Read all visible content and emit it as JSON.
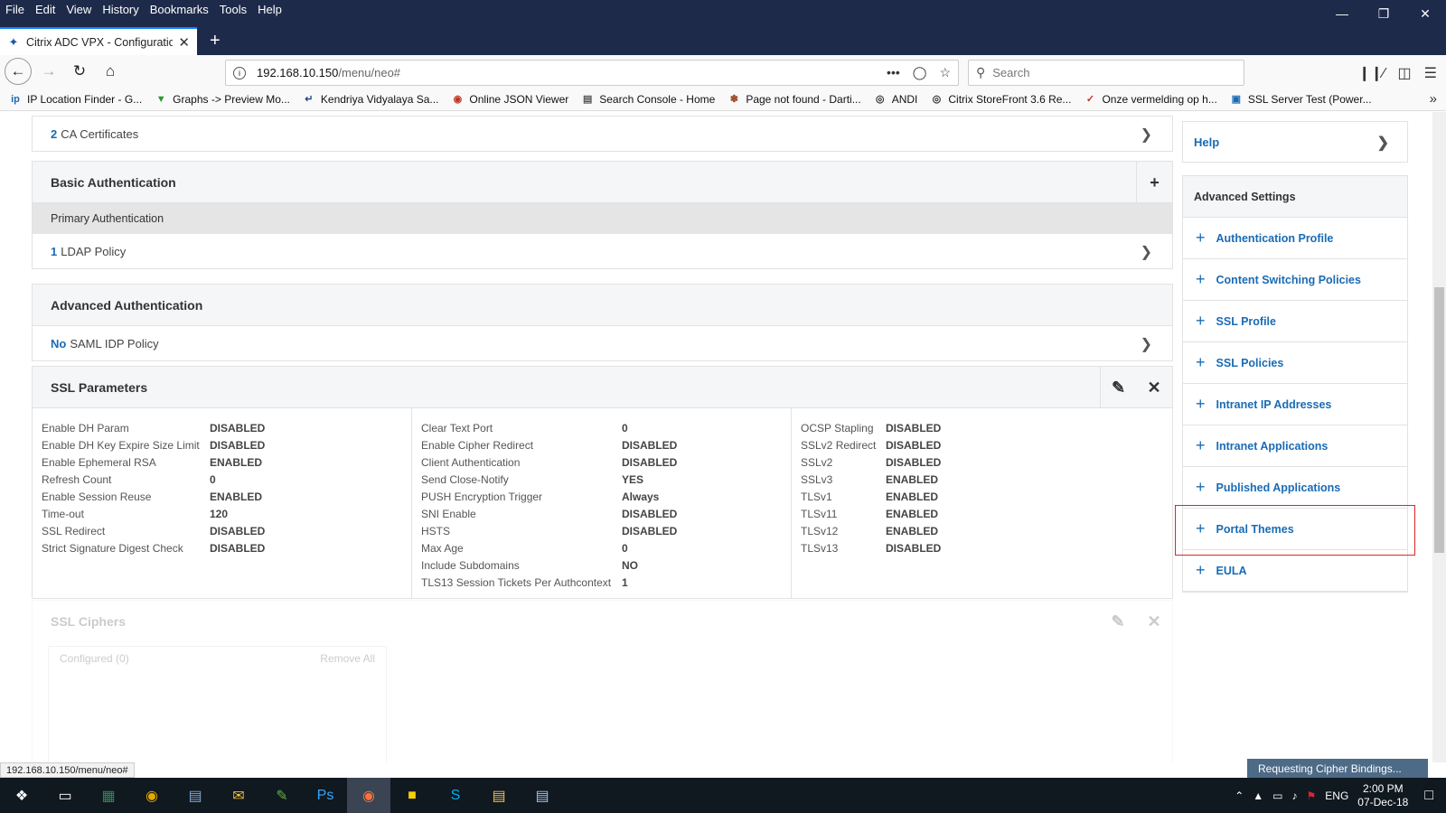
{
  "menu": [
    "File",
    "Edit",
    "View",
    "History",
    "Bookmarks",
    "Tools",
    "Help"
  ],
  "tab": {
    "title": "Citrix ADC VPX - Configuration"
  },
  "url": {
    "host": "192.168.10.150",
    "path": "/menu/neo#"
  },
  "search": {
    "placeholder": "Search"
  },
  "bookmarks": [
    {
      "icon": "ip-icon",
      "label": "IP Location Finder - G..."
    },
    {
      "icon": "leaf-icon",
      "label": "Graphs -> Preview Mo..."
    },
    {
      "icon": "kv-icon",
      "label": "Kendriya Vidyalaya Sa..."
    },
    {
      "icon": "json-icon",
      "label": "Online JSON Viewer"
    },
    {
      "icon": "console-icon",
      "label": "Search Console - Home"
    },
    {
      "icon": "dart-icon",
      "label": "Page not found - Darti..."
    },
    {
      "icon": "globe-icon",
      "label": "ANDI"
    },
    {
      "icon": "citrix-icon",
      "label": "Citrix StoreFront 3.6 Re..."
    },
    {
      "icon": "check-icon",
      "label": "Onze vermelding op h..."
    },
    {
      "icon": "lock-icon",
      "label": "SSL Server Test (Power..."
    }
  ],
  "ca": {
    "count": "2",
    "label": "CA Certificates"
  },
  "basic_auth": {
    "title": "Basic Authentication",
    "sub": "Primary Authentication",
    "count": "1",
    "label": "LDAP Policy"
  },
  "adv_auth": {
    "title": "Advanced Authentication",
    "count": "No",
    "label": "SAML IDP Policy"
  },
  "ssl": {
    "title": "SSL Parameters",
    "col1": [
      {
        "k": "Enable DH Param",
        "v": "DISABLED"
      },
      {
        "k": "Enable DH Key Expire Size Limit",
        "v": "DISABLED"
      },
      {
        "k": "Enable Ephemeral RSA",
        "v": "ENABLED"
      },
      {
        "k": "Refresh Count",
        "v": "0"
      },
      {
        "k": "Enable Session Reuse",
        "v": "ENABLED"
      },
      {
        "k": "Time-out",
        "v": "120"
      },
      {
        "k": "SSL Redirect",
        "v": "DISABLED"
      },
      {
        "k": "Strict Signature Digest Check",
        "v": "DISABLED"
      }
    ],
    "col2": [
      {
        "k": "Clear Text Port",
        "v": "0"
      },
      {
        "k": "Enable Cipher Redirect",
        "v": "DISABLED"
      },
      {
        "k": "Client Authentication",
        "v": "DISABLED"
      },
      {
        "k": "Send Close-Notify",
        "v": "YES"
      },
      {
        "k": "PUSH Encryption Trigger",
        "v": "Always"
      },
      {
        "k": "SNI Enable",
        "v": "DISABLED"
      },
      {
        "k": "HSTS",
        "v": "DISABLED"
      },
      {
        "k": "Max Age",
        "v": "0"
      },
      {
        "k": "Include Subdomains",
        "v": "NO"
      },
      {
        "k": "TLS13 Session Tickets Per Authcontext",
        "v": "1"
      }
    ],
    "col3": [
      {
        "k": "OCSP Stapling",
        "v": "DISABLED"
      },
      {
        "k": "SSLv2 Redirect",
        "v": "DISABLED"
      },
      {
        "k": "SSLv2",
        "v": "DISABLED"
      },
      {
        "k": "SSLv3",
        "v": "ENABLED"
      },
      {
        "k": "TLSv1",
        "v": "ENABLED"
      },
      {
        "k": "TLSv11",
        "v": "ENABLED"
      },
      {
        "k": "TLSv12",
        "v": "ENABLED"
      },
      {
        "k": "TLSv13",
        "v": "DISABLED"
      }
    ]
  },
  "ciphers": {
    "title": "SSL Ciphers",
    "configured": "Configured (0)",
    "remove": "Remove All"
  },
  "sidebar": {
    "help": "Help",
    "adv_title": "Advanced Settings",
    "items": [
      "Authentication Profile",
      "Content Switching Policies",
      "SSL Profile",
      "SSL Policies",
      "Intranet IP Addresses",
      "Intranet Applications",
      "Published Applications",
      "Portal Themes",
      "EULA"
    ]
  },
  "status": {
    "url": "192.168.10.150/menu/neo#",
    "request": "Requesting Cipher Bindings..."
  },
  "tray": {
    "lang": "ENG",
    "time": "2:00 PM",
    "date": "07-Dec-18"
  }
}
